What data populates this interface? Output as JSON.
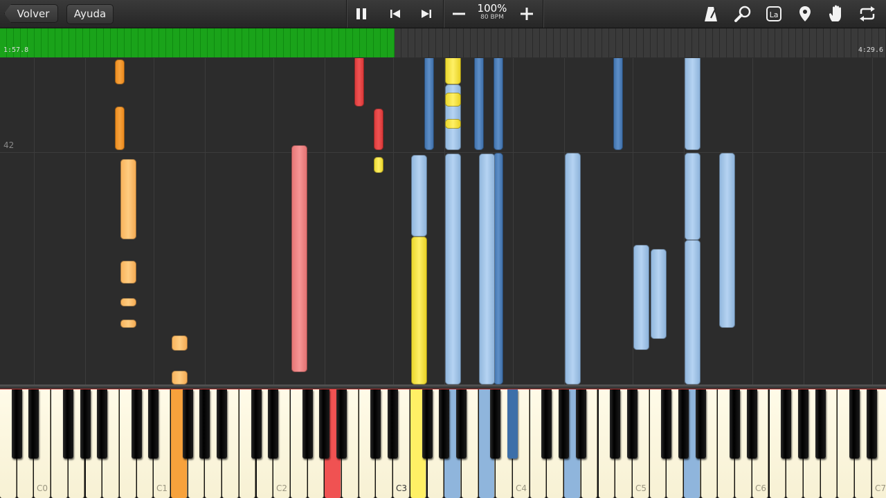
{
  "toolbar": {
    "back_label": "Volver",
    "help_label": "Ayuda",
    "tempo_percent": "100%",
    "tempo_bpm": "80 BPM",
    "note_label_icon_text": "La"
  },
  "progress": {
    "elapsed": "1:57.8",
    "total": "4:29.6",
    "fraction": 0.445
  },
  "roll": {
    "measure_number": "42"
  },
  "keyboard": {
    "octave_labels": [
      "C0",
      "C1",
      "C2",
      "C3",
      "C4",
      "C5",
      "C6",
      "C7"
    ]
  },
  "colors": {
    "progress": "#1aa31a",
    "left_hand_orange": "#f7a23c",
    "red": "#f05252",
    "yellow": "#fff065",
    "dark_blue": "#5e8fc8",
    "light_blue": "#b5d3f2"
  }
}
